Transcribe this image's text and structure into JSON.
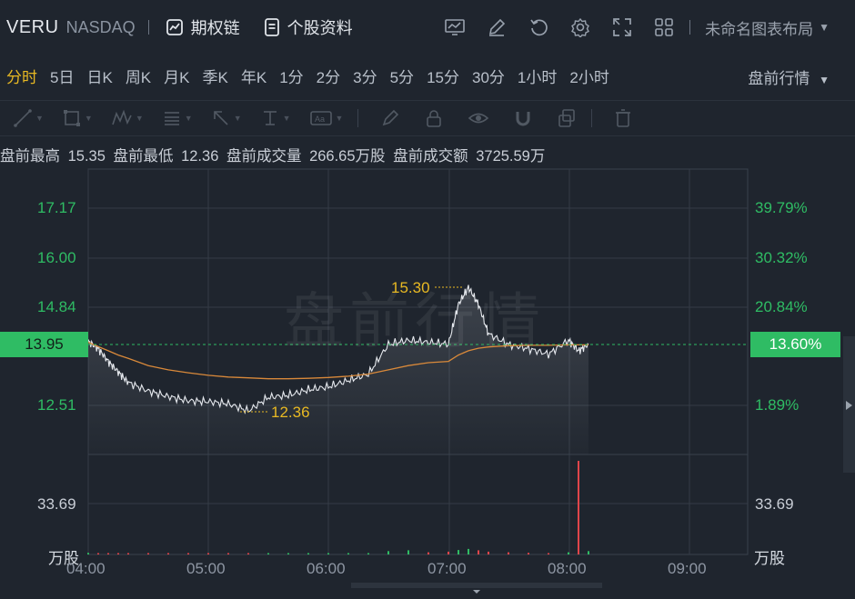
{
  "header": {
    "ticker": "VERU",
    "exchange": "NASDAQ",
    "options_chain": "期权链",
    "stock_info": "个股资料",
    "layout_name": "未命名图表布局"
  },
  "periods": [
    "分时",
    "5日",
    "日K",
    "周K",
    "月K",
    "季K",
    "年K",
    "1分",
    "2分",
    "3分",
    "5分",
    "15分",
    "30分",
    "1小时",
    "2小时"
  ],
  "active_period": "分时",
  "session": "盘前行情",
  "stats": {
    "high_label": "盘前最高",
    "high": "15.35",
    "low_label": "盘前最低",
    "low": "12.36",
    "vol_label": "盘前成交量",
    "vol": "266.65万股",
    "amt_label": "盘前成交额",
    "amt": "3725.59万"
  },
  "watermark": "盘前行情",
  "price_axis_left": [
    "17.17",
    "16.00",
    "14.84",
    "12.51"
  ],
  "price_axis_right": [
    "39.79%",
    "30.32%",
    "20.84%",
    "1.89%"
  ],
  "volume_axis_left": "33.69",
  "volume_axis_right": "33.69",
  "volume_unit": "万股",
  "current_price": "13.95",
  "current_pct": "13.60%",
  "high_marker": "15.30",
  "low_marker": "12.36",
  "time_axis": [
    "04:00",
    "05:00",
    "06:00",
    "07:00",
    "08:00",
    "09:00"
  ],
  "colors": {
    "up": "#2fbc64",
    "down": "#e0454a",
    "accent": "#e8b923",
    "price_line": "#e6e9ee",
    "avg_line": "#d9893a"
  },
  "chart_data": {
    "type": "line",
    "x": [
      "04:00",
      "04:05",
      "04:10",
      "04:15",
      "04:20",
      "04:30",
      "04:40",
      "04:50",
      "05:00",
      "05:10",
      "05:20",
      "05:30",
      "05:40",
      "05:50",
      "06:00",
      "06:10",
      "06:20",
      "06:30",
      "06:40",
      "06:50",
      "07:00",
      "07:05",
      "07:10",
      "07:15",
      "07:20",
      "07:30",
      "07:40",
      "07:50",
      "08:00",
      "08:05",
      "08:10"
    ],
    "series": [
      {
        "name": "price",
        "values": [
          14.02,
          13.85,
          13.55,
          13.3,
          13.05,
          12.85,
          12.72,
          12.62,
          12.6,
          12.55,
          12.38,
          12.7,
          12.75,
          12.88,
          12.95,
          13.1,
          13.25,
          13.95,
          14.05,
          14.0,
          13.96,
          14.9,
          15.3,
          14.9,
          14.2,
          13.95,
          13.85,
          13.72,
          14.05,
          13.8,
          13.95
        ]
      },
      {
        "name": "avg",
        "values": [
          14.0,
          13.9,
          13.8,
          13.7,
          13.62,
          13.45,
          13.35,
          13.28,
          13.22,
          13.18,
          13.16,
          13.14,
          13.14,
          13.15,
          13.17,
          13.2,
          13.25,
          13.35,
          13.45,
          13.52,
          13.55,
          13.7,
          13.8,
          13.86,
          13.89,
          13.92,
          13.93,
          13.93,
          13.94,
          13.94,
          13.94
        ]
      }
    ],
    "volume": [
      0.6,
      0.5,
      0.4,
      0.5,
      0.3,
      0.4,
      0.3,
      0.3,
      0.4,
      0.3,
      0.5,
      0.4,
      0.3,
      0.4,
      0.3,
      0.4,
      0.5,
      1.2,
      1.5,
      0.8,
      1.0,
      1.6,
      2.0,
      1.5,
      1.0,
      0.8,
      0.6,
      0.5,
      0.8,
      33.69,
      1.2
    ],
    "ylim": [
      11.8,
      17.17
    ]
  }
}
